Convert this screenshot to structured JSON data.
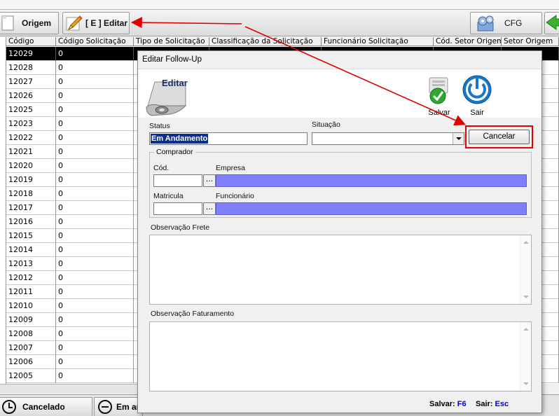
{
  "toolbar": {
    "origem_label": "Origem",
    "editar_label": "[ E ] Editar",
    "cfg_label": "CFG"
  },
  "grid": {
    "columns": [
      "Código",
      "Código Solicitação",
      "Tipo de Solicitação",
      "Classificação da Solicitação",
      "Funcionário Solicitação",
      "Cód. Setor Origem",
      "Setor Origem"
    ],
    "rows": [
      {
        "codigo": "12029",
        "cod_solic": "0"
      },
      {
        "codigo": "12028",
        "cod_solic": "0"
      },
      {
        "codigo": "12027",
        "cod_solic": "0"
      },
      {
        "codigo": "12026",
        "cod_solic": "0"
      },
      {
        "codigo": "12025",
        "cod_solic": "0"
      },
      {
        "codigo": "12023",
        "cod_solic": "0"
      },
      {
        "codigo": "12022",
        "cod_solic": "0"
      },
      {
        "codigo": "12021",
        "cod_solic": "0"
      },
      {
        "codigo": "12020",
        "cod_solic": "0"
      },
      {
        "codigo": "12019",
        "cod_solic": "0"
      },
      {
        "codigo": "12018",
        "cod_solic": "0"
      },
      {
        "codigo": "12017",
        "cod_solic": "0"
      },
      {
        "codigo": "12016",
        "cod_solic": "0"
      },
      {
        "codigo": "12015",
        "cod_solic": "0"
      },
      {
        "codigo": "12014",
        "cod_solic": "0"
      },
      {
        "codigo": "12013",
        "cod_solic": "0"
      },
      {
        "codigo": "12012",
        "cod_solic": "0"
      },
      {
        "codigo": "12011",
        "cod_solic": "0"
      },
      {
        "codigo": "12010",
        "cod_solic": "0"
      },
      {
        "codigo": "12009",
        "cod_solic": "0"
      },
      {
        "codigo": "12008",
        "cod_solic": "0"
      },
      {
        "codigo": "12007",
        "cod_solic": "0"
      },
      {
        "codigo": "12006",
        "cod_solic": "0"
      },
      {
        "codigo": "12005",
        "cod_solic": "0"
      }
    ]
  },
  "bottom_tabs": {
    "cancelado": "Cancelado",
    "em_andamento": "Em an"
  },
  "dialog": {
    "title": "Editar Follow-Up",
    "heading": "Editar",
    "salvar_label": "Salvar",
    "sair_label": "Sair",
    "status_label": "Status",
    "status_value": "Em Andamento",
    "situacao_label": "Situação",
    "situacao_value": "",
    "cancelar_label": "Cancelar",
    "comprador_title": "Comprador",
    "cod_label": "Cód.",
    "empresa_label": "Empresa",
    "matricula_label": "Matricula",
    "funcionario_label": "Funcionário",
    "dots": "...",
    "obs_frete_label": "Observação Frete",
    "obs_fat_label": "Observação Faturamento",
    "shortcut_salvar": "Salvar:",
    "shortcut_salvar_key": "F6",
    "shortcut_sair": "Sair:",
    "shortcut_sair_key": "Esc"
  },
  "colors": {
    "selection": "#0b2f8e",
    "readonly_field": "#8080ff",
    "annotation_red": "#e00000"
  }
}
